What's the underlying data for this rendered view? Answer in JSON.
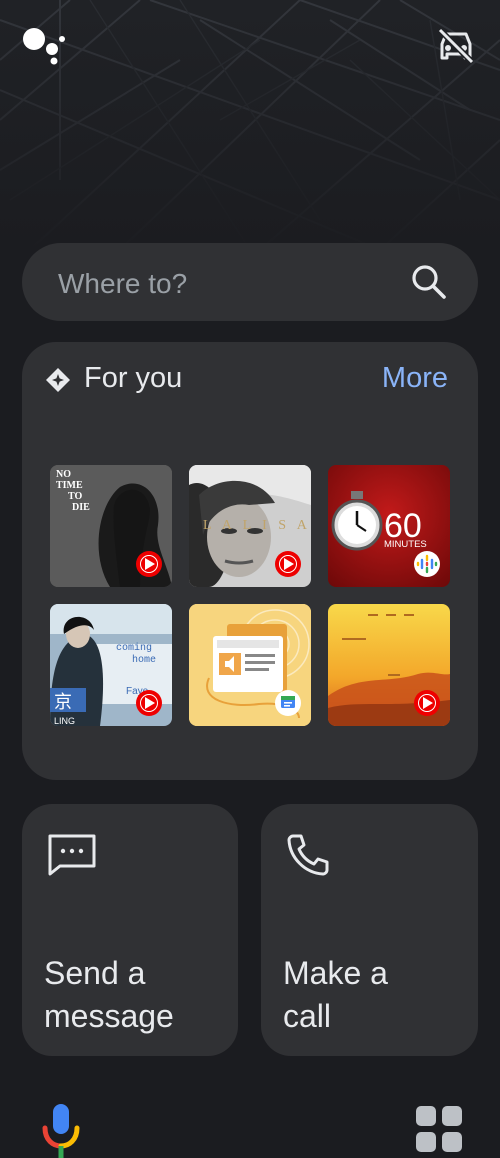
{
  "search": {
    "placeholder": "Where to?"
  },
  "for_you": {
    "title": "For you",
    "more_label": "More",
    "tiles": [
      {
        "label": "NO TIME TO DIE",
        "source": "youtube-music"
      },
      {
        "label": "LALISA",
        "source": "youtube-music"
      },
      {
        "label": "60 MINUTES",
        "source": "google-podcasts"
      },
      {
        "label": "coming home",
        "source": "youtube-music"
      },
      {
        "label": "news-article",
        "source": "google-news"
      },
      {
        "label": "sunrise-album",
        "source": "youtube-music"
      }
    ]
  },
  "actions": {
    "message_label_line1": "Send a",
    "message_label_line2": "message",
    "call_label_line1": "Make a",
    "call_label_line2": "call"
  },
  "colors": {
    "accent": "#8ab4f8",
    "card": "#303134",
    "background": "#1b1c20"
  },
  "tile_text": {
    "t1_line1": "NO",
    "t1_line2": "TIME",
    "t1_line3": "TO",
    "t1_line4": "DIE",
    "t2": "L A L I S A",
    "t3_num": "60",
    "t3_word": "MINUTES",
    "t4_line1": "coming",
    "t4_line2": "home",
    "t4_char": "京",
    "t4_sub": "LING",
    "t4_name": "Faye"
  }
}
